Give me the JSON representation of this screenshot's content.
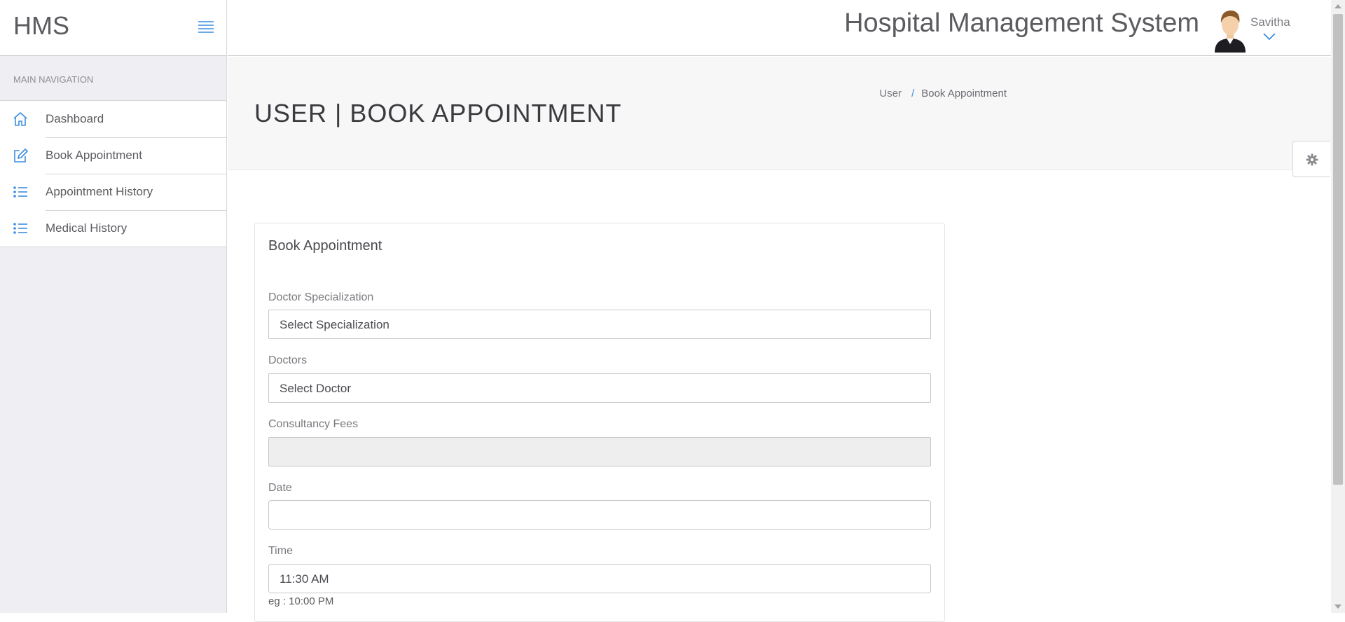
{
  "brand": "HMS",
  "app_title": "Hospital Management System",
  "user": {
    "name": "Savitha"
  },
  "sidebar": {
    "heading": "Main Navigation",
    "items": [
      {
        "label": "Dashboard",
        "icon": "home-icon"
      },
      {
        "label": "Book Appointment",
        "icon": "edit-icon"
      },
      {
        "label": "Appointment History",
        "icon": "list-icon"
      },
      {
        "label": "Medical History",
        "icon": "list-icon"
      }
    ]
  },
  "page": {
    "title": "USER | BOOK APPOINTMENT",
    "breadcrumb": [
      "User",
      "Book Appointment"
    ]
  },
  "form": {
    "title": "Book Appointment",
    "specialization": {
      "label": "Doctor Specialization",
      "value": "Select Specialization"
    },
    "doctor": {
      "label": "Doctors",
      "value": "Select Doctor"
    },
    "fees": {
      "label": "Consultancy Fees",
      "value": ""
    },
    "date": {
      "label": "Date",
      "value": ""
    },
    "time": {
      "label": "Time",
      "value": "11:30 AM",
      "hint": "eg : 10:00 PM"
    }
  },
  "colors": {
    "accent": "#3c8de0",
    "sidebar_bg": "#eeeef3",
    "title_band_bg": "#f7f7f8"
  }
}
